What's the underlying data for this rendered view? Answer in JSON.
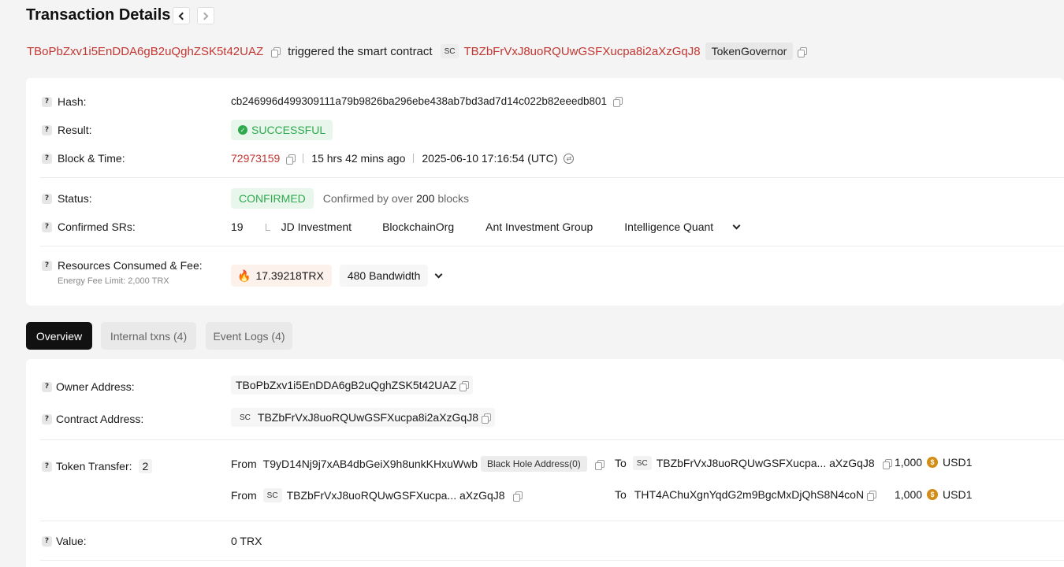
{
  "header": {
    "title": "Transaction Details",
    "prev_label": "‹",
    "next_label": "›"
  },
  "summary": {
    "owner_address": "TBoPbZxv1i5EnDDA6gB2uQghZSK5t42UAZ",
    "action_text": "triggered the smart contract",
    "sc_label": "SC",
    "contract_address": "TBZbFrVxJ8uoRQUwGSFXucpa8i2aXzGqJ8",
    "contract_name": "TokenGovernor"
  },
  "details": {
    "hash_label": "Hash:",
    "hash_value": "cb246996d499309111a79b9826ba296ebe438ab7bd3ad7d14c022b82eeedb801",
    "result_label": "Result:",
    "result_value": "SUCCESSFUL",
    "block_label": "Block & Time:",
    "block_number": "72973159",
    "time_ago": "15 hrs 42 mins ago",
    "timestamp": "2025-06-10 17:16:54 (UTC)",
    "status_label": "Status:",
    "status_value": "CONFIRMED",
    "confirmed_prefix": "Confirmed by over",
    "confirmed_count": "200",
    "confirmed_suffix": "blocks",
    "srs_label": "Confirmed SRs:",
    "srs_count": "19",
    "srs": [
      "JD Investment",
      "BlockchainOrg",
      "Ant Investment Group",
      "Intelligence Quant"
    ],
    "resources_label": "Resources Consumed & Fee:",
    "energy_fee_limit": "Energy Fee Limit: 2,000 TRX",
    "fee_value": "17.39218TRX",
    "bandwidth_value": "480 Bandwidth"
  },
  "tabs": [
    {
      "label": "Overview",
      "active": true
    },
    {
      "label": "Internal txns (4)",
      "active": false
    },
    {
      "label": "Event Logs (4)",
      "active": false
    }
  ],
  "overview": {
    "owner_label": "Owner Address:",
    "owner_value": "TBoPbZxv1i5EnDDA6gB2uQghZSK5t42UAZ",
    "contract_label": "Contract Address:",
    "contract_sc": "SC",
    "contract_value": "TBZbFrVxJ8uoRQUwGSFXucpa8i2aXzGqJ8",
    "transfer_label": "Token Transfer:",
    "transfer_count": "2",
    "transfers": [
      {
        "from_label": "From",
        "from_address": "T9yD14Nj9j7xAB4dbGeiX9h8unkKHxuWwb",
        "from_tag": "Black Hole Address(0)",
        "to_label": "To",
        "to_sc": "SC",
        "to_address": "TBZbFrVxJ8uoRQUwGSFXucpa... aXzGqJ8",
        "amount": "1,000",
        "token": "USD1"
      },
      {
        "from_label": "From",
        "from_sc": "SC",
        "from_address": "TBZbFrVxJ8uoRQUwGSFXucpa... aXzGqJ8",
        "to_label": "To",
        "to_address": "THT4AChuXgnYqdG2m9BgcMxDjQhS8N4coN",
        "amount": "1,000",
        "token": "USD1"
      }
    ],
    "value_label": "Value:",
    "value_value": "0 TRX"
  },
  "colors": {
    "accent_red": "#c23631",
    "success_green": "#2fa94e",
    "tab_active": "#111111"
  }
}
